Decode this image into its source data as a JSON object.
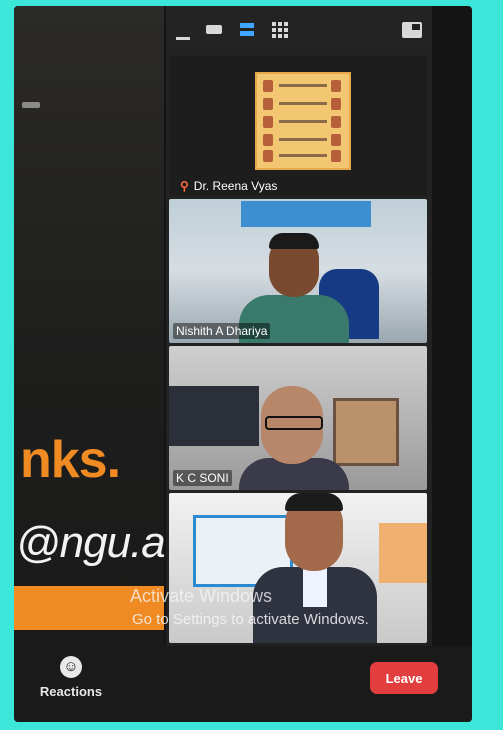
{
  "toolbar": {
    "icons": [
      "minimize-icon",
      "speaker-view-icon",
      "gallery-strip-icon",
      "grid-view-icon",
      "exit-fullscreen-icon"
    ]
  },
  "participants": [
    {
      "name": "Dr. Reena Vyas"
    },
    {
      "name": "Nishith A Dhariya"
    },
    {
      "name": "K C SONI"
    },
    {
      "name": ""
    }
  ],
  "slide": {
    "big_text": "nks.",
    "email_text": "@ngu.a"
  },
  "activation": {
    "title": "Activate Windows",
    "subtitle": "Go to Settings to activate Windows."
  },
  "bottom_bar": {
    "reactions_label": "Reactions",
    "leave_label": "Leave"
  },
  "colors": {
    "accent": "#f08a22",
    "leave": "#e33e3e",
    "frame": "#3ce6d9"
  }
}
